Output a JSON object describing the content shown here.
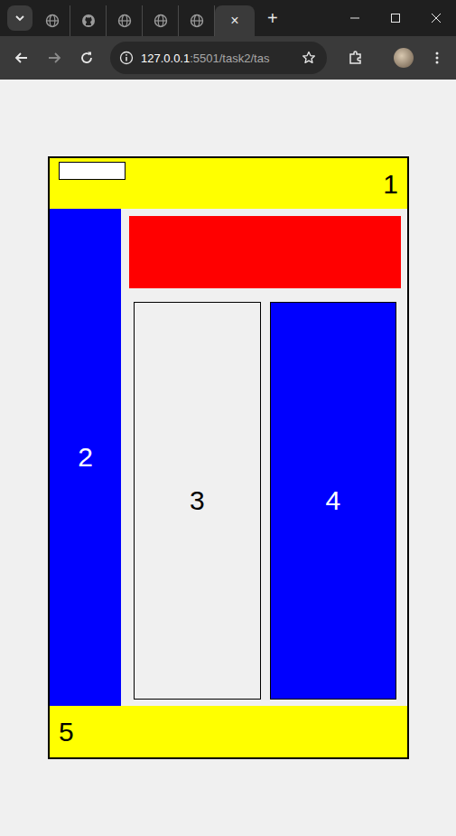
{
  "browser": {
    "tabs": [
      {
        "kind": "globe",
        "selected": false
      },
      {
        "kind": "github",
        "selected": false
      },
      {
        "kind": "globe",
        "selected": false
      },
      {
        "kind": "globe",
        "selected": false
      },
      {
        "kind": "globe",
        "selected": false
      },
      {
        "kind": "globe",
        "selected": true
      }
    ],
    "close_tab": "×",
    "new_tab": "+",
    "toolbar": {
      "back_disabled": false,
      "forward_disabled": true,
      "address_host": "127.0.0.1",
      "address_path": ":5501/task2/tas"
    }
  },
  "page": {
    "header": {
      "label": "1",
      "input_value": ""
    },
    "sidebar": {
      "label": "2"
    },
    "columns": [
      {
        "label": "3",
        "kind": "light",
        "color": "#f0f0f0"
      },
      {
        "label": "4",
        "kind": "dark",
        "color": "#0000ff"
      }
    ],
    "footer": {
      "label": "5"
    }
  }
}
